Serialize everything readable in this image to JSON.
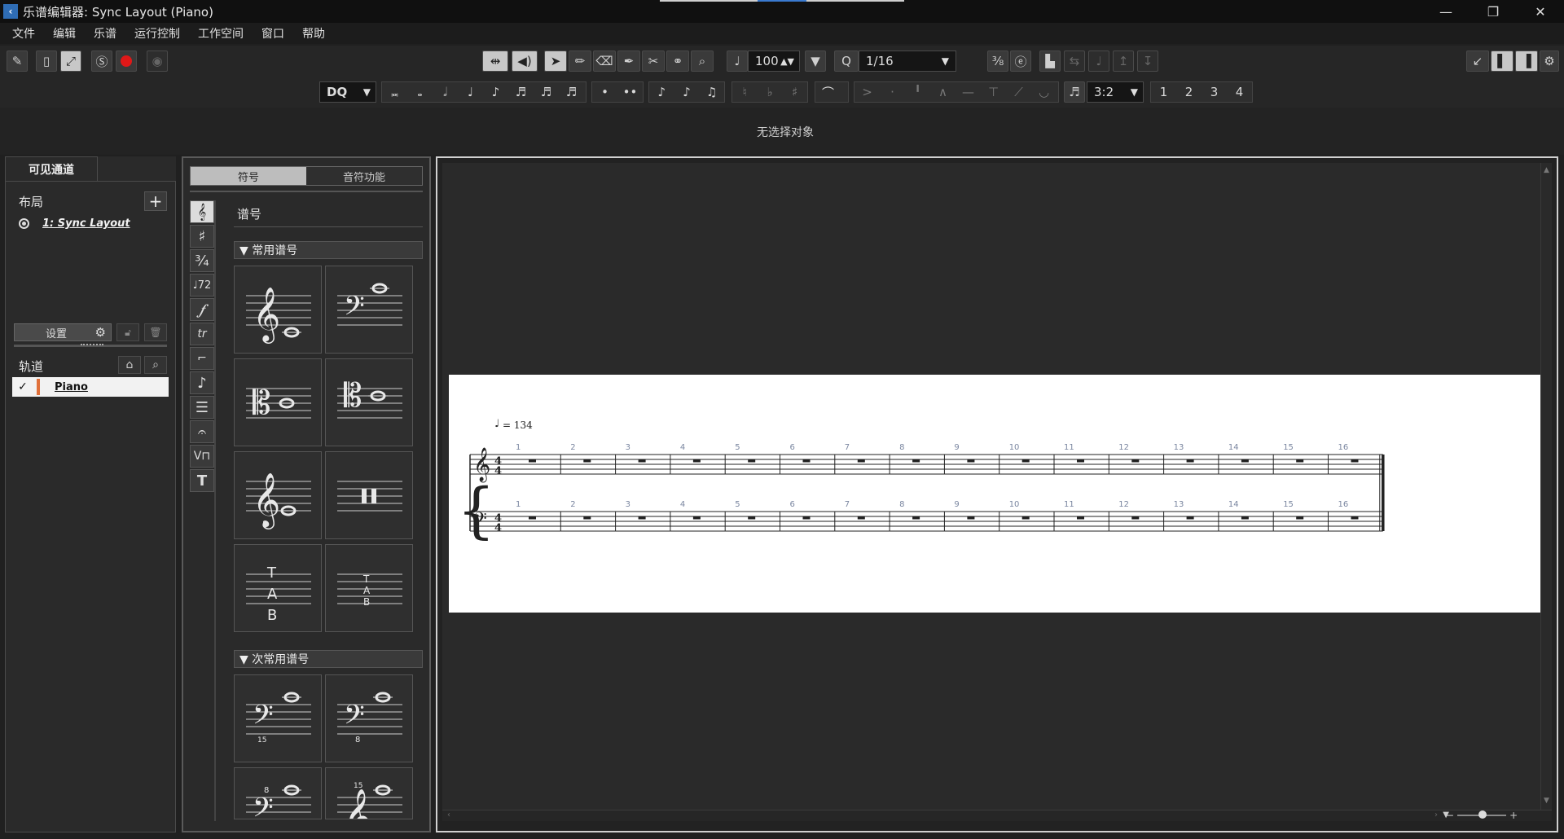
{
  "window": {
    "title": "乐谱编辑器: Sync Layout (Piano)",
    "minimize": "—",
    "restore": "❐",
    "close": "✕"
  },
  "menu": [
    "文件",
    "编辑",
    "乐谱",
    "运行控制",
    "工作空间",
    "窗口",
    "帮助"
  ],
  "toolbar": {
    "velocity_value": "100",
    "quantize_value": "1/16",
    "note_length_value": "DQ",
    "tuplet_value": "3:2",
    "voices": [
      "1",
      "2",
      "3",
      "4"
    ]
  },
  "status": {
    "selection": "无选择对象"
  },
  "left_panel": {
    "tab_label": "可见通道",
    "layout_label": "布局",
    "layout_item": "1: Sync Layout",
    "settings_label": "设置",
    "tracks_label": "轨道",
    "tracks": [
      {
        "name": "Piano",
        "checked": "✓",
        "color": "#e0703a"
      }
    ]
  },
  "symbols_panel": {
    "tabs": [
      "符号",
      "音符功能"
    ],
    "active_tab": "符号",
    "section_title": "谱号",
    "common_header": "▼ 常用谱号",
    "less_common_header": "▼ 次常用谱号",
    "tab_letters": [
      "T",
      "A",
      "B"
    ]
  },
  "score": {
    "tempo_text": "= 134",
    "time_signature_top": "4",
    "time_signature_bottom": "4",
    "bar_numbers": [
      "1",
      "2",
      "3",
      "4",
      "5",
      "6",
      "7",
      "8",
      "9",
      "10",
      "11",
      "12",
      "13",
      "14",
      "15",
      "16"
    ]
  }
}
